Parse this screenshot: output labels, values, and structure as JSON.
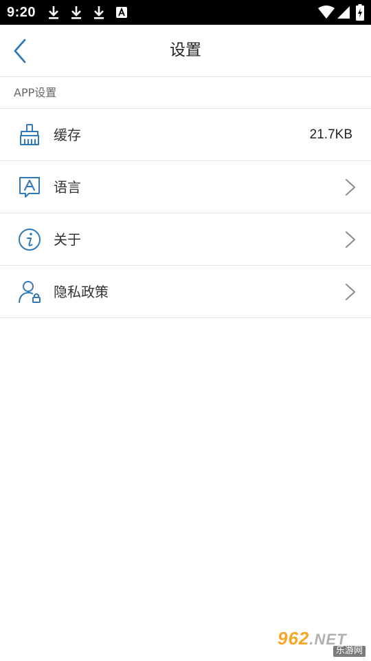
{
  "status_bar": {
    "time": "9:20",
    "notification_icons": [
      "download-icon",
      "download-icon",
      "download-icon",
      "font-app-icon"
    ],
    "system_icons": [
      "wifi-icon",
      "signal-icon",
      "battery-charging-icon"
    ]
  },
  "header": {
    "title": "设置",
    "back_icon": "chevron-left-icon"
  },
  "section": {
    "label": "APP设置"
  },
  "rows": [
    {
      "label": "缓存",
      "icon": "broom-icon",
      "value": "21.7KB",
      "has_chevron": false
    },
    {
      "label": "语言",
      "icon": "language-icon",
      "value": "",
      "has_chevron": true
    },
    {
      "label": "关于",
      "icon": "info-icon",
      "value": "",
      "has_chevron": true
    },
    {
      "label": "隐私政策",
      "icon": "user-lock-icon",
      "value": "",
      "has_chevron": true
    }
  ],
  "watermark": {
    "brand": "962",
    "suffix": ".NET",
    "sub": "乐游网"
  },
  "colors": {
    "accent": "#2e78b7",
    "divider": "#e2e2e2",
    "status_bar_bg": "#000000",
    "chevron": "#8a8a8a"
  }
}
